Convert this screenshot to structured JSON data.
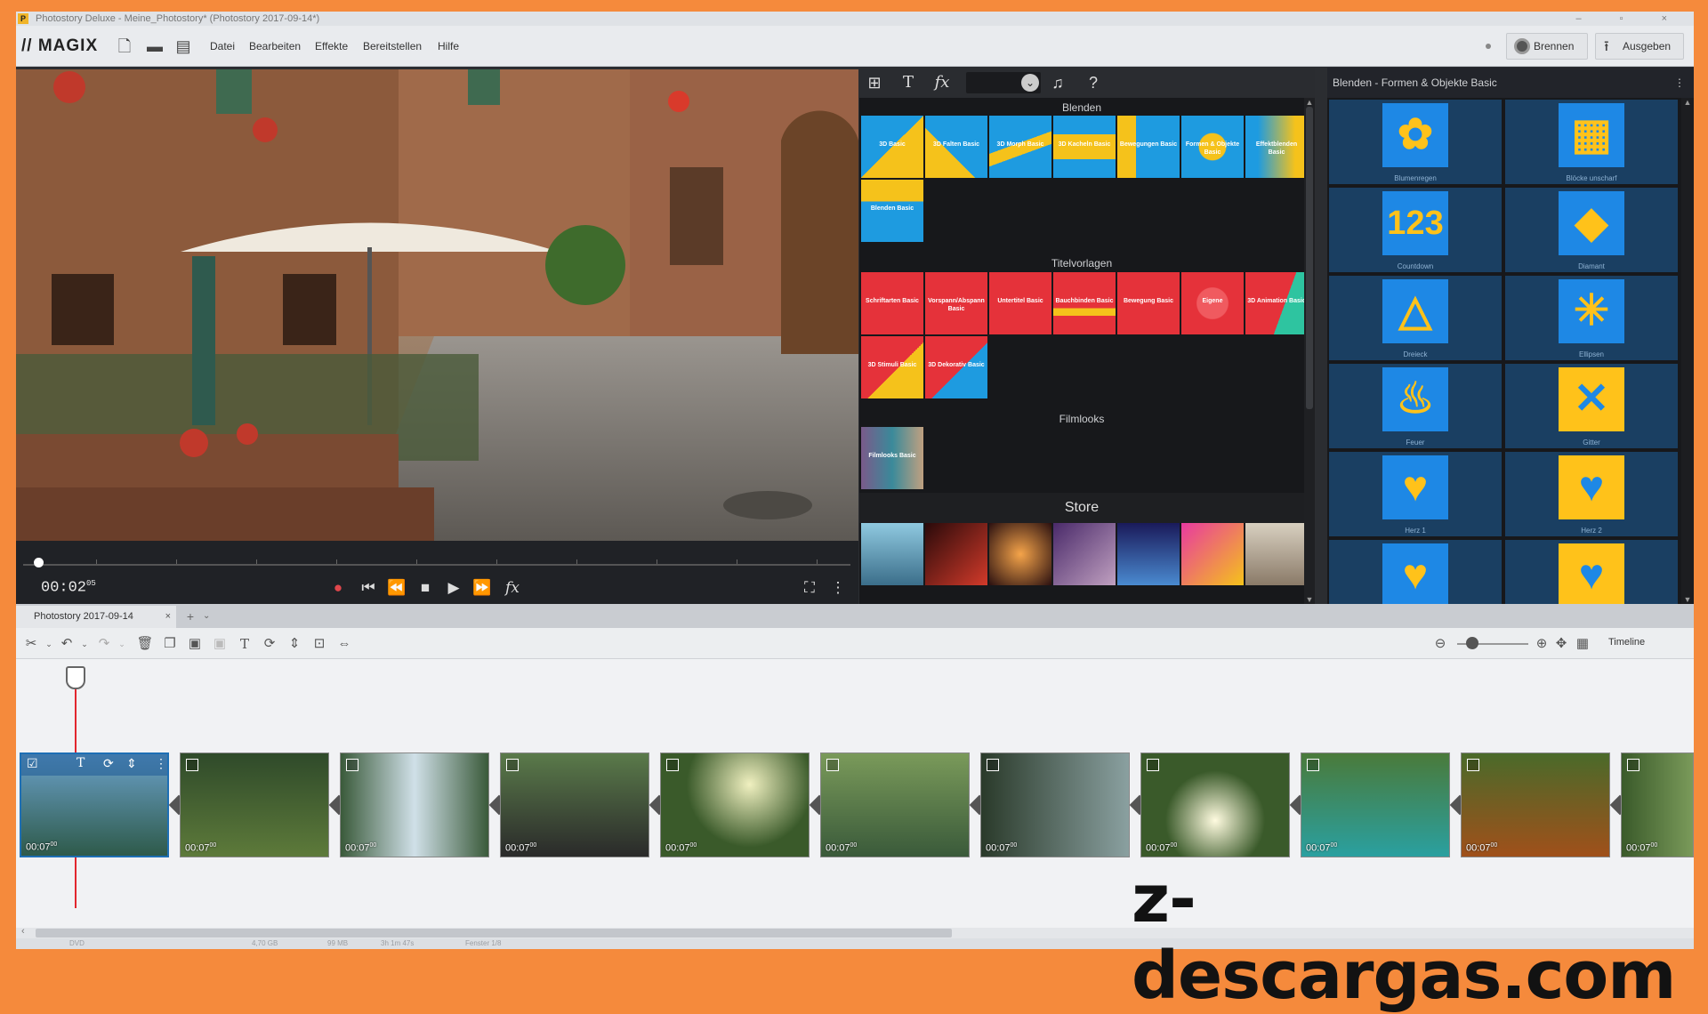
{
  "window": {
    "title": "Photostory Deluxe - Meine_Photostory* (Photostory 2017-09-14*)",
    "controls": "– ▫ ×"
  },
  "app": {
    "logo": "// MAGIX"
  },
  "menu": {
    "items": [
      "Datei",
      "Bearbeiten",
      "Effekte",
      "Bereitstellen",
      "Hilfe"
    ]
  },
  "actions": {
    "burn": "Brennen",
    "output": "Ausgeben"
  },
  "player": {
    "timecode": "00:02",
    "frames": "05"
  },
  "media_panel": {
    "sections": {
      "transitions": "Blenden",
      "titles": "Titelvorlagen",
      "filmlooks": "Filmlooks",
      "store": "Store"
    },
    "transition_tiles": [
      "3D Basic",
      "3D Falten Basic",
      "3D Morph Basic",
      "3D Kacheln Basic",
      "Bewegungen Basic",
      "Formen & Objekte Basic",
      "Effektblenden Basic",
      "Blenden Basic"
    ],
    "title_tiles": [
      "Schriftarten Basic",
      "Vorspann/Abspann Basic",
      "Untertitel Basic",
      "Bauchbinden Basic",
      "Bewegung Basic",
      "Eigene",
      "3D Animation Basic",
      "3D Stimuli Basic",
      "3D Dekorativ Basic"
    ],
    "filmlook_tiles": [
      "Filmlooks Basic"
    ]
  },
  "shapes_panel": {
    "title": "Blenden - Formen & Objekte Basic",
    "items": [
      {
        "label": "Blumenregen",
        "glyph": "✿"
      },
      {
        "label": "Blöcke unscharf",
        "glyph": "▦"
      },
      {
        "label": "Countdown",
        "glyph": "123"
      },
      {
        "label": "Diamant",
        "glyph": "◆"
      },
      {
        "label": "Dreieck",
        "glyph": "△"
      },
      {
        "label": "Ellipsen",
        "glyph": "✳"
      },
      {
        "label": "Feuer",
        "glyph": "♨"
      },
      {
        "label": "Gitter",
        "glyph": "✕"
      },
      {
        "label": "Herz 1",
        "glyph": "♥"
      },
      {
        "label": "Herz 2",
        "glyph": "♥"
      },
      {
        "label": "",
        "glyph": "♥"
      },
      {
        "label": "",
        "glyph": "♥"
      }
    ]
  },
  "project": {
    "tab": "Photostory 2017-09-14"
  },
  "timeline": {
    "mode": "Timeline",
    "clip_duration": "00:07",
    "clip_frames": "00"
  },
  "status": {
    "items": [
      "DVD",
      "4,70 GB",
      "99 MB",
      "3h 1m 47s",
      "Fenster 1/8"
    ]
  },
  "watermark": "z-descargas.com"
}
